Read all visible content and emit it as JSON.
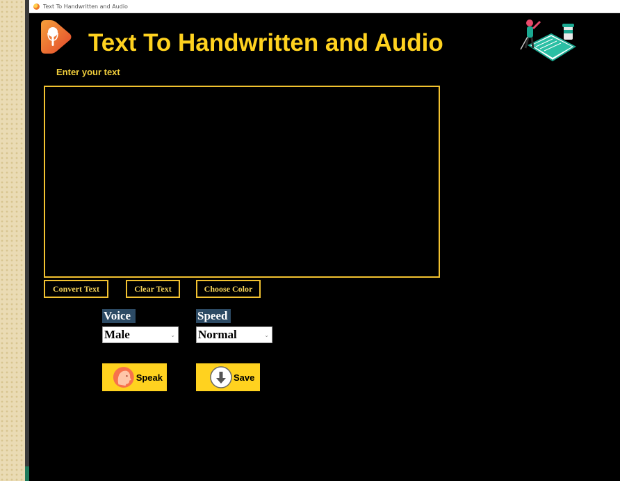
{
  "window": {
    "title": "Text To Handwritten and Audio"
  },
  "header": {
    "title": "Text To Handwritten and Audio"
  },
  "input": {
    "label": "Enter your text",
    "value": ""
  },
  "toolbar": {
    "convert_label": "Convert Text",
    "clear_label": "Clear Text",
    "color_label": "Choose Color"
  },
  "voice": {
    "label": "Voice",
    "selected": "Male"
  },
  "speed": {
    "label": "Speed",
    "selected": "Normal"
  },
  "actions": {
    "speak_label": "Speak",
    "save_label": "Save"
  },
  "colors": {
    "background": "#000000",
    "accent": "#ffd21f",
    "border": "#f2c230",
    "label_bg": "#2c4a64"
  },
  "icons": {
    "app": "app-icon",
    "logo": "microphone-logo-icon",
    "speak": "speaking-head-icon",
    "save": "download-arrow-icon"
  }
}
